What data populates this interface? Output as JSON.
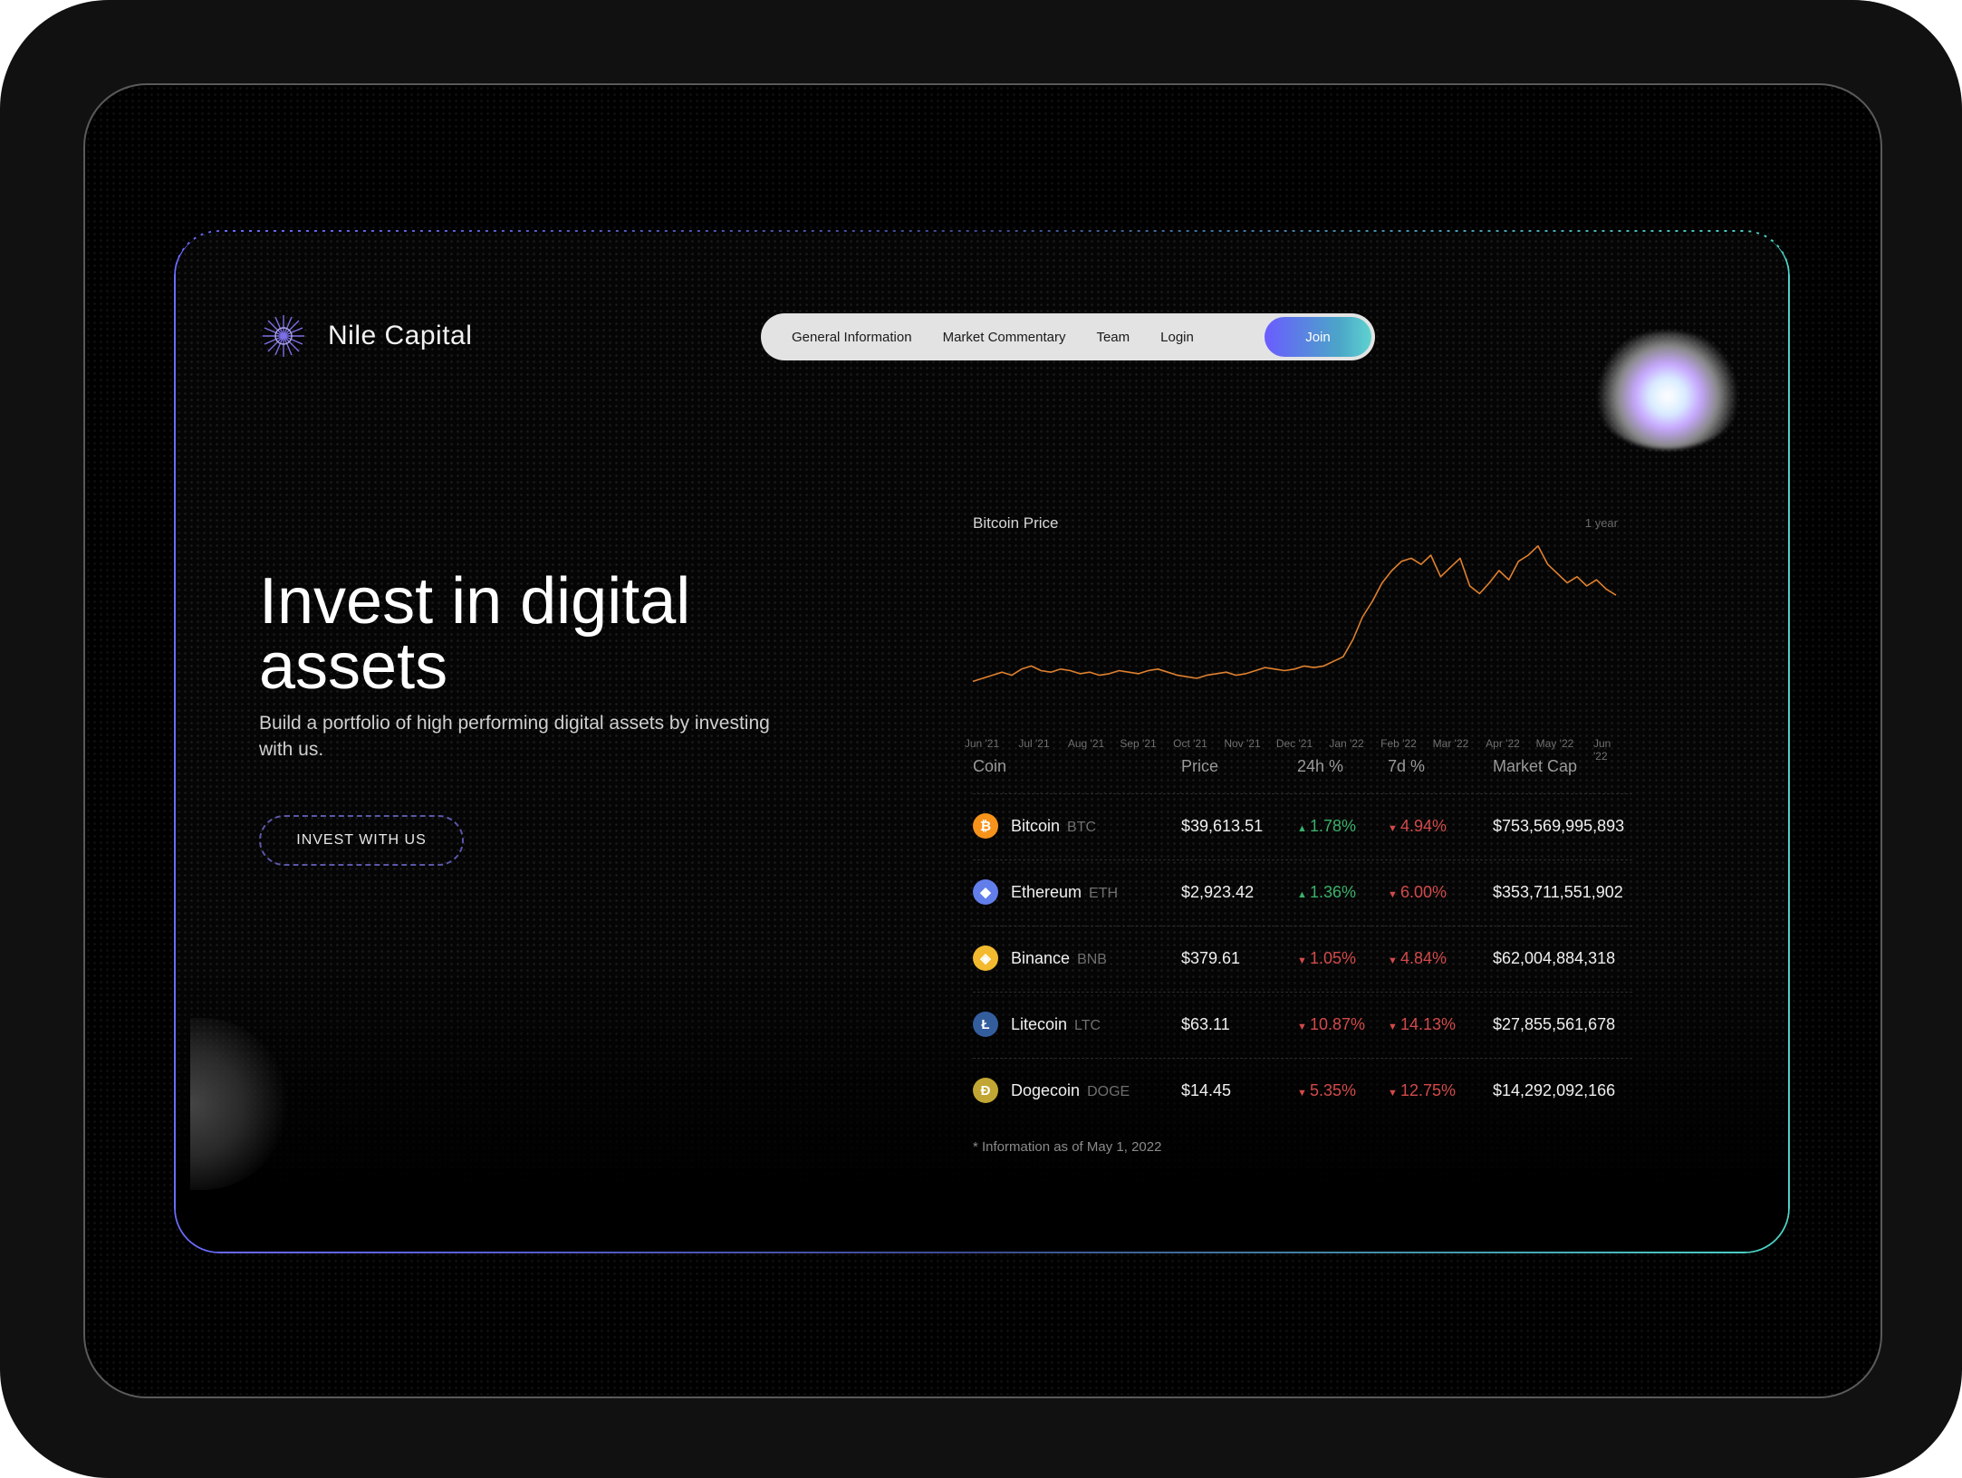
{
  "brand": {
    "name": "Nile Capital"
  },
  "nav": {
    "items": [
      "General Information",
      "Market Commentary",
      "Team",
      "Login"
    ],
    "join_label": "Join"
  },
  "hero": {
    "title_line1": "Invest in digital",
    "title_line2": "assets",
    "subtitle": "Build a portfolio of high performing digital assets by investing with us.",
    "cta_label": "INVEST WITH US"
  },
  "chart": {
    "title": "Bitcoin Price",
    "range_label": "1 year",
    "color": "#e0812f"
  },
  "chart_data": {
    "type": "line",
    "title": "Bitcoin Price",
    "x": [
      "Jun '21",
      "Jul '21",
      "Aug '21",
      "Sep '21",
      "Oct '21",
      "Nov '21",
      "Dec '21",
      "Jan '22",
      "Feb '22",
      "Mar '22",
      "Apr '22",
      "May '22",
      "Jun '22"
    ],
    "series": [
      {
        "values": [
          8,
          10,
          12,
          14,
          12,
          16,
          18,
          15,
          14,
          16,
          15,
          13,
          14,
          12,
          13,
          15,
          14,
          13,
          15,
          16,
          14,
          12,
          11,
          10,
          12,
          13,
          14,
          12,
          13,
          15,
          17,
          16,
          15,
          16,
          18,
          17,
          18,
          21,
          24,
          35,
          50,
          60,
          72,
          80,
          86,
          88,
          84,
          90,
          76,
          82,
          88,
          70,
          65,
          72,
          80,
          74,
          86,
          90,
          96,
          84,
          78,
          72,
          76,
          70,
          74,
          68,
          64
        ]
      }
    ],
    "xlabel": "",
    "ylabel": ""
  },
  "table": {
    "headers": {
      "coin": "Coin",
      "price": "Price",
      "h24": "24h %",
      "d7": "7d %",
      "mcap": "Market Cap"
    },
    "rows": [
      {
        "name": "Bitcoin",
        "symbol": "BTC",
        "price": "$39,613.51",
        "h24": "1.78%",
        "h24_dir": "up",
        "d7": "4.94%",
        "d7_dir": "down",
        "mcap": "$753,569,995,893",
        "icon": "bitcoin-icon",
        "icon_glyph": "₿",
        "icon_color": "#f7931a"
      },
      {
        "name": "Ethereum",
        "symbol": "ETH",
        "price": "$2,923.42",
        "h24": "1.36%",
        "h24_dir": "up",
        "d7": "6.00%",
        "d7_dir": "down",
        "mcap": "$353,711,551,902",
        "icon": "ethereum-icon",
        "icon_glyph": "◆",
        "icon_color": "#627eea"
      },
      {
        "name": "Binance",
        "symbol": "BNB",
        "price": "$379.61",
        "h24": "1.05%",
        "h24_dir": "down",
        "d7": "4.84%",
        "d7_dir": "down",
        "mcap": "$62,004,884,318",
        "icon": "binance-icon",
        "icon_glyph": "◈",
        "icon_color": "#f3ba2f"
      },
      {
        "name": "Litecoin",
        "symbol": "LTC",
        "price": "$63.11",
        "h24": "10.87%",
        "h24_dir": "down",
        "d7": "14.13%",
        "d7_dir": "down",
        "mcap": "$27,855,561,678",
        "icon": "litecoin-icon",
        "icon_glyph": "Ł",
        "icon_color": "#345d9d"
      },
      {
        "name": "Dogecoin",
        "symbol": "DOGE",
        "price": "$14.45",
        "h24": "5.35%",
        "h24_dir": "down",
        "d7": "12.75%",
        "d7_dir": "down",
        "mcap": "$14,292,092,166",
        "icon": "dogecoin-icon",
        "icon_glyph": "Ð",
        "icon_color": "#c2a633"
      }
    ],
    "footnote": "* Information as of May 1, 2022"
  }
}
